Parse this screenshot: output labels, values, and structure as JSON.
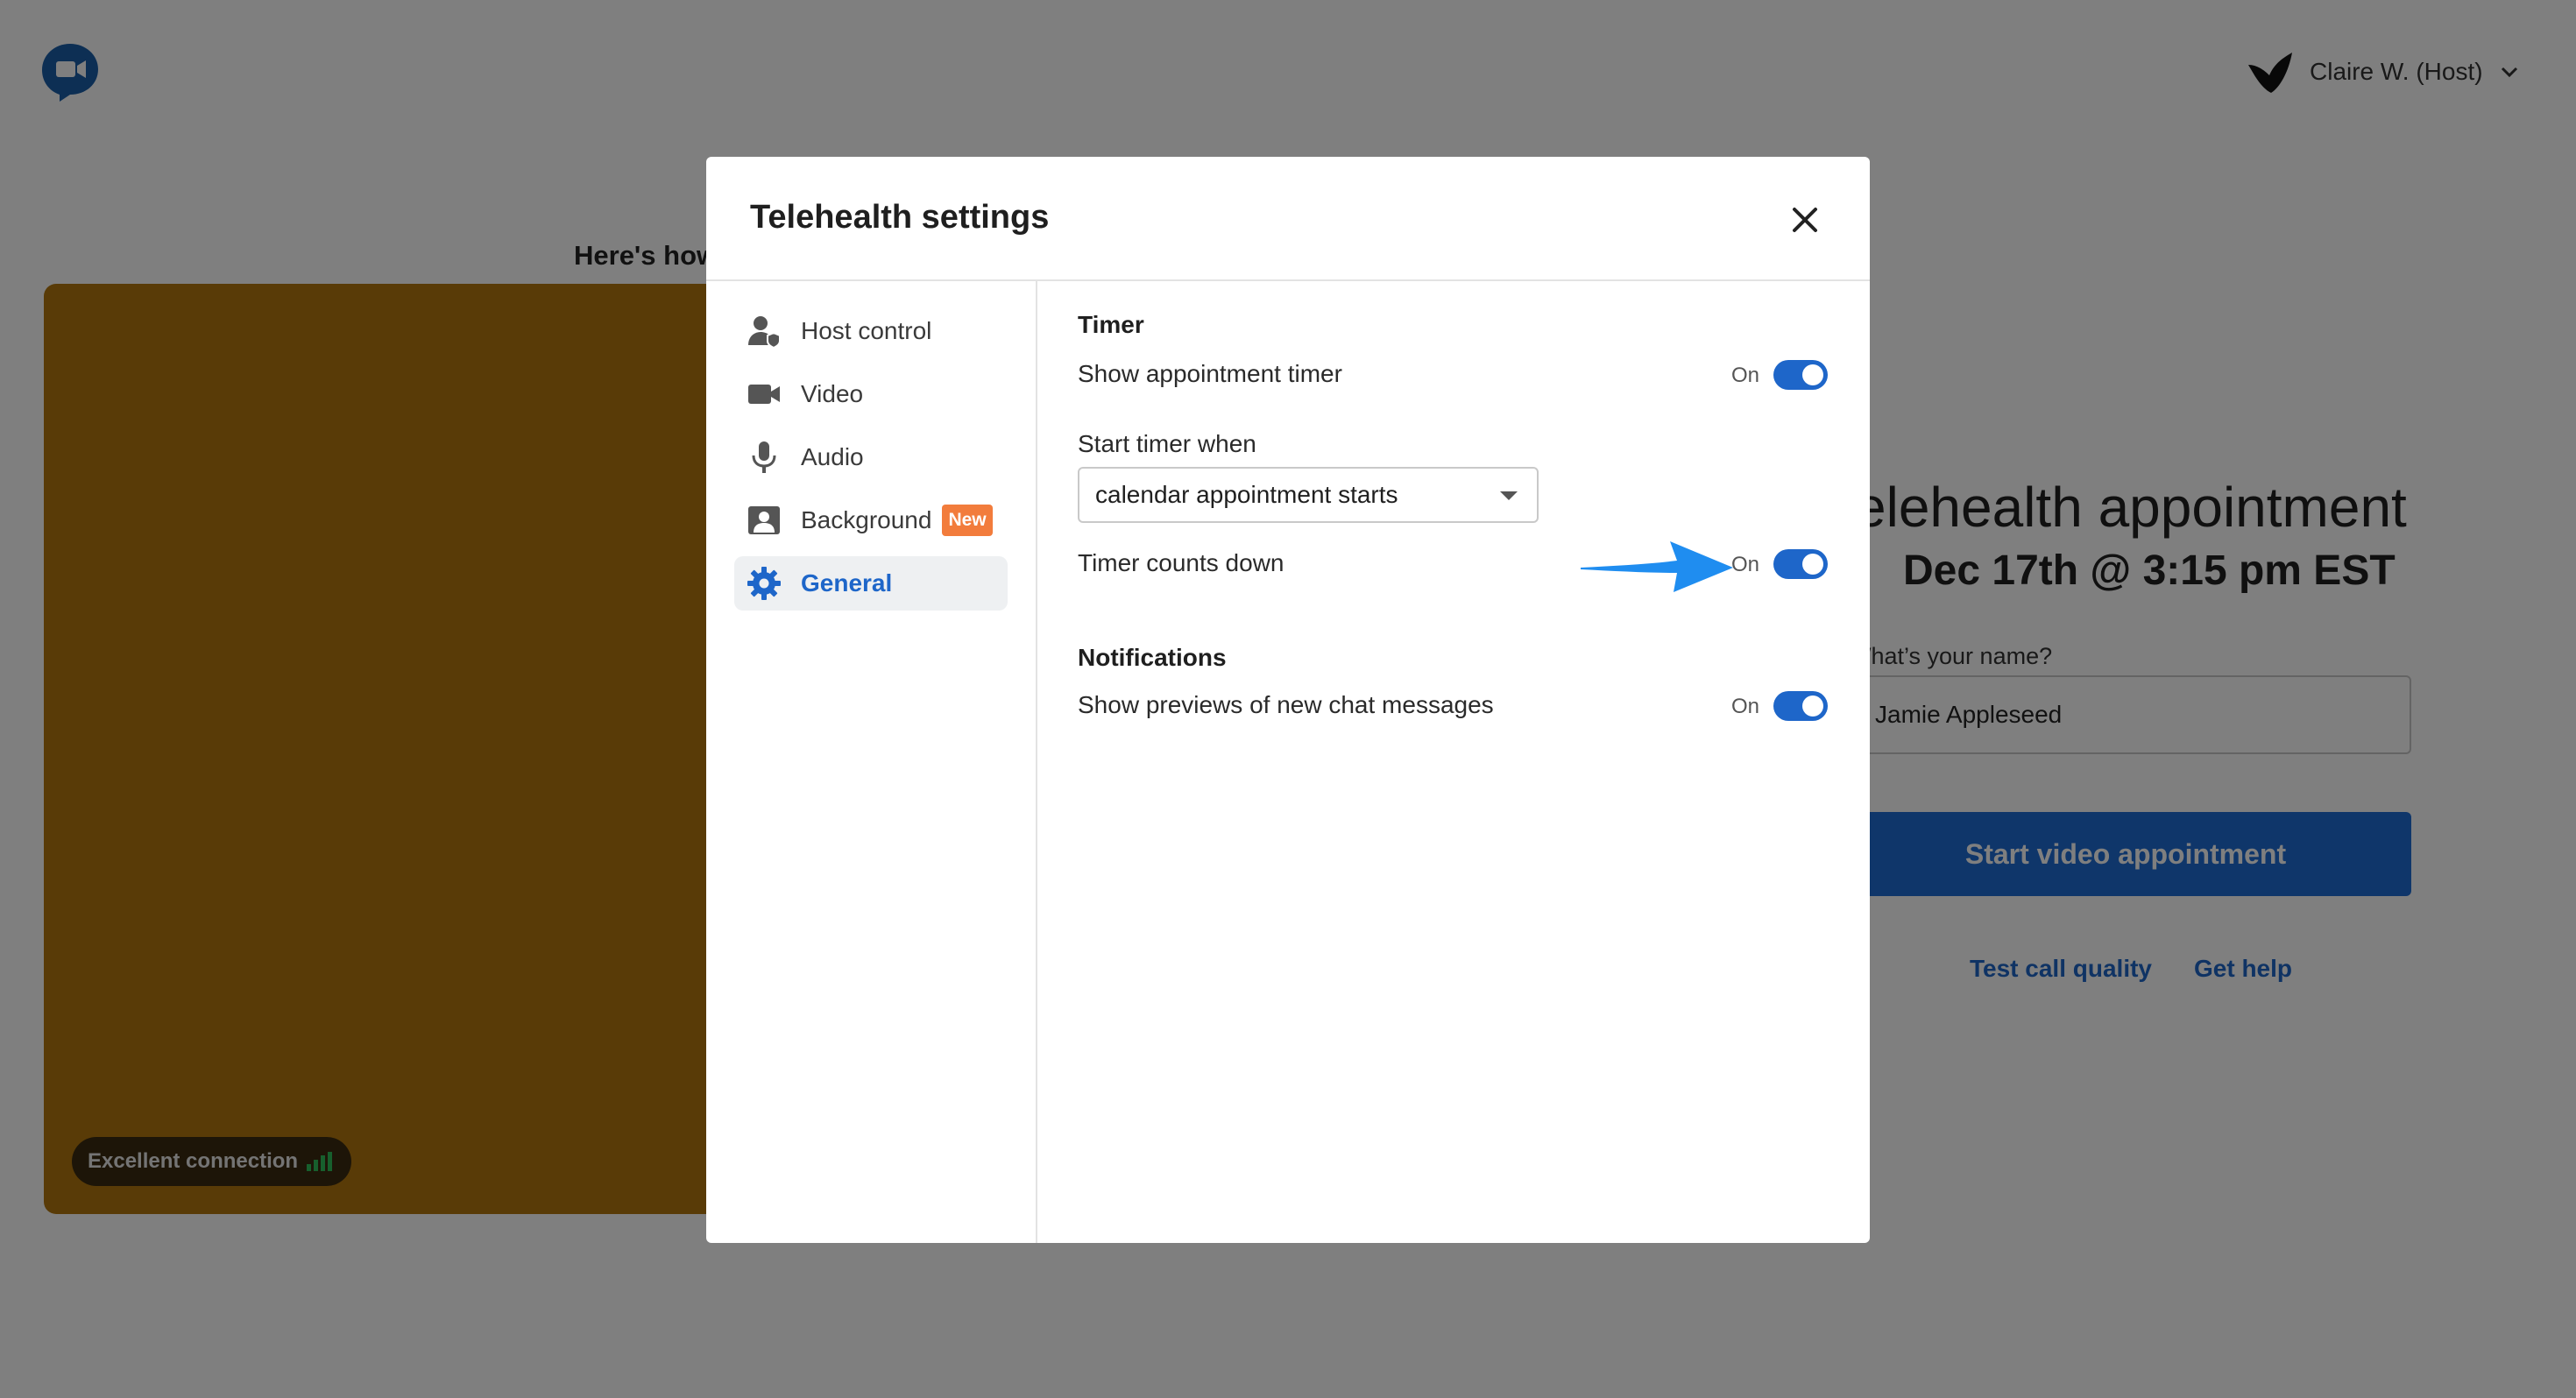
{
  "header": {
    "user_name": "Claire W. (Host)"
  },
  "preview": {
    "caption": "Here's how",
    "connection_label": "Excellent connection"
  },
  "appointment": {
    "title": "Telehealth appointment",
    "date": "Dec 17th @ 3:15 pm EST",
    "name_label": "What’s your name?",
    "name_value": "Jamie Appleseed",
    "start_button": "Start video appointment",
    "links": {
      "test_call": "Test call quality",
      "help": "Get help"
    }
  },
  "modal": {
    "title": "Telehealth settings",
    "nav": [
      {
        "label": "Host control",
        "icon": "host-control-icon"
      },
      {
        "label": "Video",
        "icon": "video-camera-icon"
      },
      {
        "label": "Audio",
        "icon": "microphone-icon"
      },
      {
        "label": "Background",
        "icon": "background-icon",
        "badge": "New"
      },
      {
        "label": "General",
        "icon": "gear-icon",
        "active": true
      }
    ],
    "timer": {
      "section_title": "Timer",
      "show_timer_label": "Show appointment timer",
      "show_timer_state": "On",
      "start_when_label": "Start timer when",
      "start_when_value": "calendar appointment starts",
      "counts_down_label": "Timer counts down",
      "counts_down_state": "On"
    },
    "notifications": {
      "section_title": "Notifications",
      "previews_label": "Show previews of new chat messages",
      "previews_state": "On"
    }
  },
  "colors": {
    "accent": "#1e66c9",
    "badge_new": "#f27c3c",
    "arrow": "#1f8df0",
    "preview_bg": "#b2770f"
  }
}
